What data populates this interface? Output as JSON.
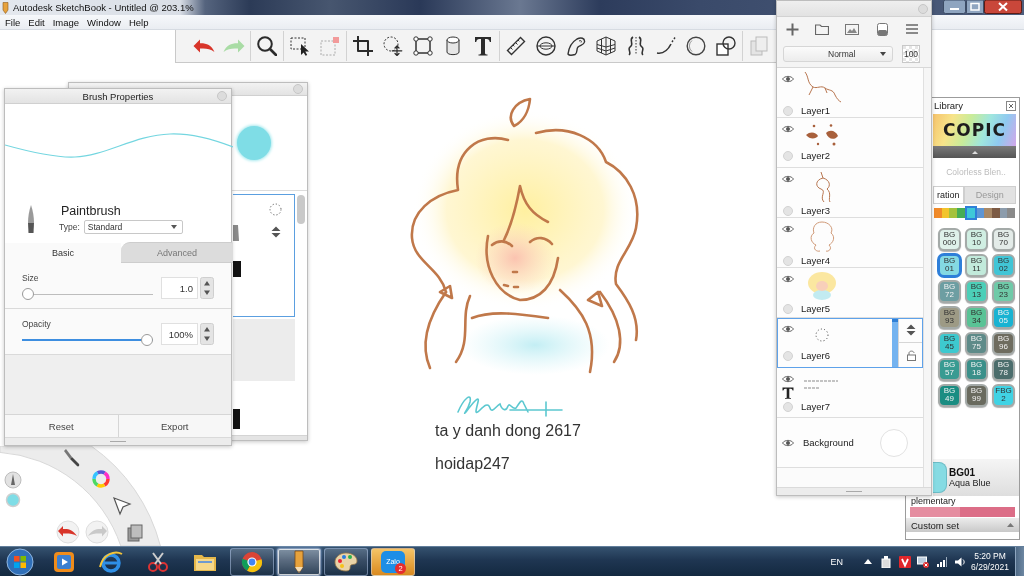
{
  "window": {
    "title": "Autodesk SketchBook - Untitled @ 203.1%"
  },
  "menu": [
    "File",
    "Edit",
    "Image",
    "Window",
    "Help"
  ],
  "toolbar": {
    "redo": {
      "disabled": true
    }
  },
  "brush_properties": {
    "title": "Brush Properties",
    "brush_name": "Paintbrush",
    "type_label": "Type:",
    "type_value": "Standard",
    "tabs": [
      {
        "label": "Basic",
        "selected": true
      },
      {
        "label": "Advanced",
        "selected": false
      }
    ],
    "settings": [
      {
        "label": "Size",
        "value": "1.0",
        "level": 0
      },
      {
        "label": "Opacity",
        "value": "100%",
        "level": 1
      }
    ],
    "buttons": [
      "Reset",
      "Export"
    ]
  },
  "canvas": {
    "texts": [
      "ta y danh dong 2617",
      "hoidap247"
    ]
  },
  "layers": {
    "blend_mode": "Normal",
    "opacity": "100",
    "items": [
      {
        "name": "Layer1",
        "kind": "paint",
        "visible": true,
        "selected": false
      },
      {
        "name": "Layer2",
        "kind": "paint",
        "visible": true,
        "selected": false
      },
      {
        "name": "Layer3",
        "kind": "paint",
        "visible": true,
        "selected": false
      },
      {
        "name": "Layer4",
        "kind": "paint",
        "visible": true,
        "selected": false
      },
      {
        "name": "Layer5",
        "kind": "paint",
        "visible": true,
        "selected": false
      },
      {
        "name": "Layer6",
        "kind": "paint",
        "visible": true,
        "selected": true
      },
      {
        "name": "Layer7",
        "kind": "text",
        "visible": true,
        "selected": false
      },
      {
        "name": "Background",
        "kind": "background",
        "visible": true,
        "selected": false
      }
    ]
  },
  "library": {
    "title": "Library",
    "logo": "COPIC",
    "set_name": "Colorless Blen..",
    "tabs": [
      {
        "label": "ration",
        "selected": true
      },
      {
        "label": "Design",
        "selected": false
      }
    ],
    "palette": [
      {
        "color": "#f08a2a",
        "selected": false
      },
      {
        "color": "#f2c42c",
        "selected": false
      },
      {
        "color": "#a4c23c",
        "selected": false
      },
      {
        "color": "#46ad55",
        "selected": false
      },
      {
        "color": "#3ec8d8",
        "selected": true
      },
      {
        "color": "#5d95d4",
        "selected": false
      },
      {
        "color": "#a88866",
        "selected": false
      },
      {
        "color": "#7c5a44",
        "selected": false
      },
      {
        "color": "#8c9cac",
        "selected": false
      },
      {
        "color": "#8a8a8a",
        "selected": false
      }
    ],
    "markers": [
      {
        "series": "BG",
        "number": "000",
        "color": "#dff1ea",
        "selected": false
      },
      {
        "series": "BG",
        "number": "10",
        "color": "#d0eee2",
        "selected": false
      },
      {
        "series": "BG",
        "number": "70",
        "color": "#e3ebe8",
        "selected": false
      },
      {
        "series": "BG",
        "number": "01",
        "color": "#84d9e3",
        "selected": true
      },
      {
        "series": "BG",
        "number": "11",
        "color": "#c2eadb",
        "selected": false
      },
      {
        "series": "BG",
        "number": "02",
        "color": "#41c5d6",
        "selected": false
      },
      {
        "series": "BG",
        "number": "72",
        "color": "#6d9ea2",
        "selected": false
      },
      {
        "series": "BG",
        "number": "13",
        "color": "#4ccfb8",
        "selected": false
      },
      {
        "series": "BG",
        "number": "23",
        "color": "#6fcaa8",
        "selected": false
      },
      {
        "series": "BG",
        "number": "93",
        "color": "#9d9a85",
        "selected": false
      },
      {
        "series": "BG",
        "number": "34",
        "color": "#5ac396",
        "selected": false
      },
      {
        "series": "BG",
        "number": "05",
        "color": "#19b3d2",
        "selected": false
      },
      {
        "series": "BG",
        "number": "45",
        "color": "#3dc9cf",
        "selected": false
      },
      {
        "series": "BG",
        "number": "75",
        "color": "#5e8b89",
        "selected": false
      },
      {
        "series": "BG",
        "number": "96",
        "color": "#6e6c5f",
        "selected": false
      },
      {
        "series": "BG",
        "number": "57",
        "color": "#389b92",
        "selected": false
      },
      {
        "series": "BG",
        "number": "18",
        "color": "#3b908a",
        "selected": false
      },
      {
        "series": "BG",
        "number": "78",
        "color": "#4b6d6c",
        "selected": false
      },
      {
        "series": "BG",
        "number": "49",
        "color": "#1a8d82",
        "selected": false
      },
      {
        "series": "BG",
        "number": "99",
        "color": "#696a5e",
        "selected": false
      },
      {
        "series": "FBG",
        "number": "2",
        "color": "#40d3e4",
        "selected": false
      }
    ],
    "current": {
      "code": "BG01",
      "name": "Aqua Blue"
    },
    "complementary_label": "plementary",
    "custom_set_label": "Custom set"
  },
  "taskbar": {
    "apps": [
      {
        "kind": "player",
        "running": false,
        "selected": false,
        "attention": false
      },
      {
        "kind": "browser",
        "running": false,
        "selected": false,
        "attention": false
      },
      {
        "kind": "scissors",
        "running": false,
        "selected": false,
        "attention": false
      },
      {
        "kind": "folder",
        "running": false,
        "selected": false,
        "attention": false
      },
      {
        "kind": "round-browser",
        "running": true,
        "selected": false,
        "attention": false
      },
      {
        "kind": "pencil",
        "running": true,
        "selected": true,
        "attention": false
      },
      {
        "kind": "palette",
        "running": true,
        "selected": false,
        "attention": false
      },
      {
        "kind": "chat",
        "label": "Zalo",
        "badge": "2",
        "running": true,
        "selected": false,
        "attention": true
      }
    ],
    "language": "EN",
    "time": "5:20 PM",
    "date": "6/29/2021"
  }
}
